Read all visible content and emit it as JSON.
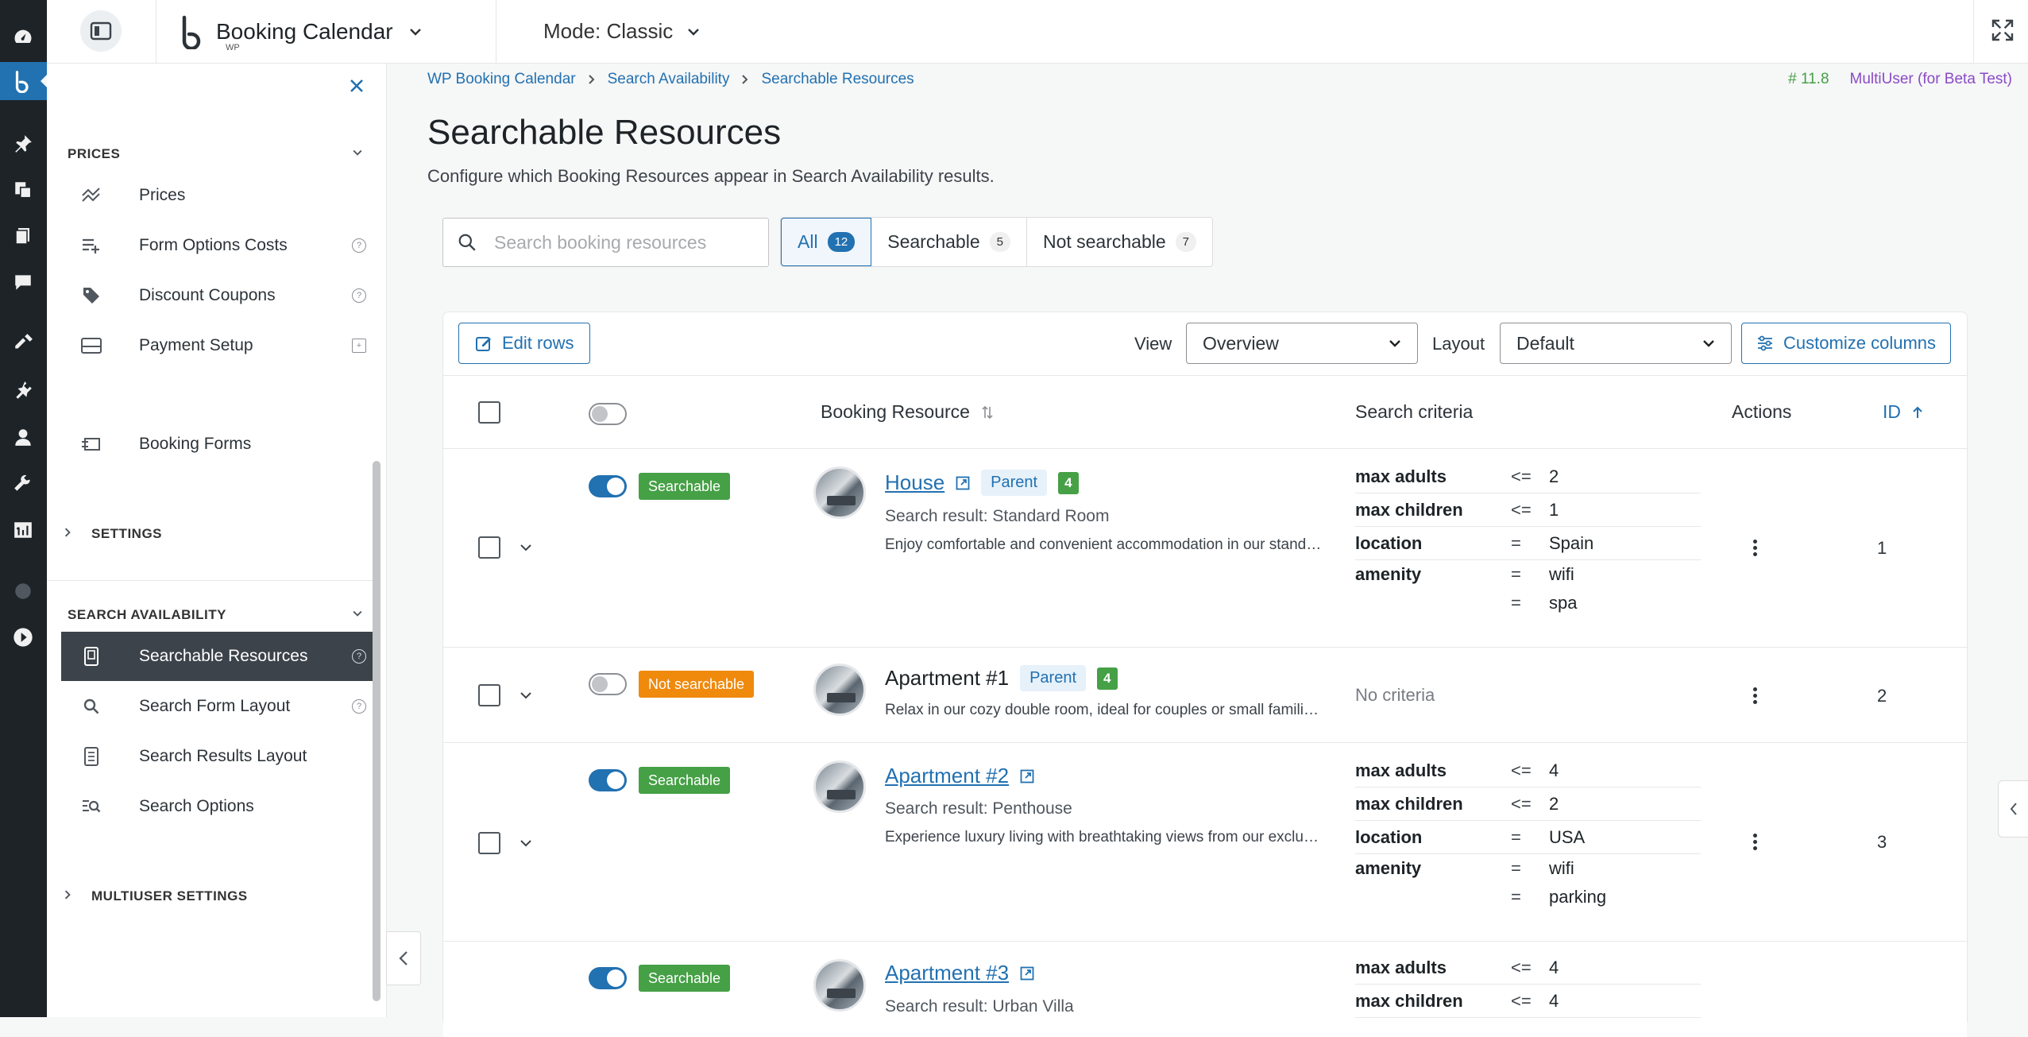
{
  "topbar": {
    "app_title": "Booking Calendar",
    "app_sub": "WP",
    "mode_label": "Mode: Classic"
  },
  "sidebar": {
    "prices_section": "PRICES",
    "items_prices": [
      {
        "label": "Prices",
        "icon": "chart-icon"
      },
      {
        "label": "Form Options Costs",
        "icon": "list-plus-icon",
        "help": "?"
      },
      {
        "label": "Discount Coupons",
        "icon": "tag-icon",
        "help": "?"
      },
      {
        "label": "Payment Setup",
        "icon": "card-icon",
        "help": "+"
      }
    ],
    "booking_forms": "Booking Forms",
    "settings_section": "SETTINGS",
    "search_section": "SEARCH AVAILABILITY",
    "items_search": [
      {
        "label": "Searchable Resources",
        "help": "?"
      },
      {
        "label": "Search Form Layout",
        "help": "?"
      },
      {
        "label": "Search Results Layout"
      },
      {
        "label": "Search Options"
      }
    ],
    "multiuser_section": "MULTIUSER SETTINGS"
  },
  "breadcrumb": [
    "WP Booking Calendar",
    "Search Availability",
    "Searchable Resources"
  ],
  "version": {
    "number": "# 11.8",
    "edition": "MultiUser (for Beta Test)"
  },
  "page": {
    "title": "Searchable Resources",
    "subtitle": "Configure which Booking Resources appear in Search Availability results."
  },
  "search": {
    "placeholder": "Search booking resources"
  },
  "filters": [
    {
      "label": "All",
      "count": "12"
    },
    {
      "label": "Searchable",
      "count": "5"
    },
    {
      "label": "Not searchable",
      "count": "7"
    }
  ],
  "toolbar": {
    "edit_rows": "Edit rows",
    "view_label": "View",
    "view_value": "Overview",
    "layout_label": "Layout",
    "layout_value": "Default",
    "customize": "Customize columns"
  },
  "columns": {
    "resource": "Booking Resource",
    "criteria": "Search criteria",
    "actions": "Actions",
    "id": "ID"
  },
  "rows": [
    {
      "status": "Searchable",
      "name": "House",
      "parent": "Parent",
      "count": "4",
      "result": "Search result: Standard Room",
      "desc": "Enjoy comfortable and convenient accommodation in our standar...",
      "criteria": [
        {
          "k": "max adults",
          "o": "<=",
          "v": "2"
        },
        {
          "k": "max children",
          "o": "<=",
          "v": "1"
        },
        {
          "k": "location",
          "o": "=",
          "v": "Spain"
        },
        {
          "k": "amenity",
          "o": "=",
          "v": "wifi"
        },
        {
          "k": "",
          "o": "=",
          "v": "spa"
        }
      ],
      "id": "1"
    },
    {
      "status": "Not searchable",
      "name": "Apartment #1",
      "parent": "Parent",
      "count": "4",
      "desc": "Relax in our cozy double room, ideal for couples or small families....",
      "no_criteria": "No criteria",
      "id": "2"
    },
    {
      "status": "Searchable",
      "name": "Apartment #2",
      "result": "Search result: Penthouse",
      "desc": "Experience luxury living with breathtaking views from our exclusiv...",
      "criteria": [
        {
          "k": "max adults",
          "o": "<=",
          "v": "4"
        },
        {
          "k": "max children",
          "o": "<=",
          "v": "2"
        },
        {
          "k": "location",
          "o": "=",
          "v": "USA"
        },
        {
          "k": "amenity",
          "o": "=",
          "v": "wifi"
        },
        {
          "k": "",
          "o": "=",
          "v": "parking"
        }
      ],
      "id": "3"
    },
    {
      "status": "Searchable",
      "name": "Apartment #3",
      "result": "Search result: Urban Villa",
      "criteria": [
        {
          "k": "max adults",
          "o": "<=",
          "v": "4"
        },
        {
          "k": "max children",
          "o": "<=",
          "v": "4"
        }
      ]
    }
  ]
}
